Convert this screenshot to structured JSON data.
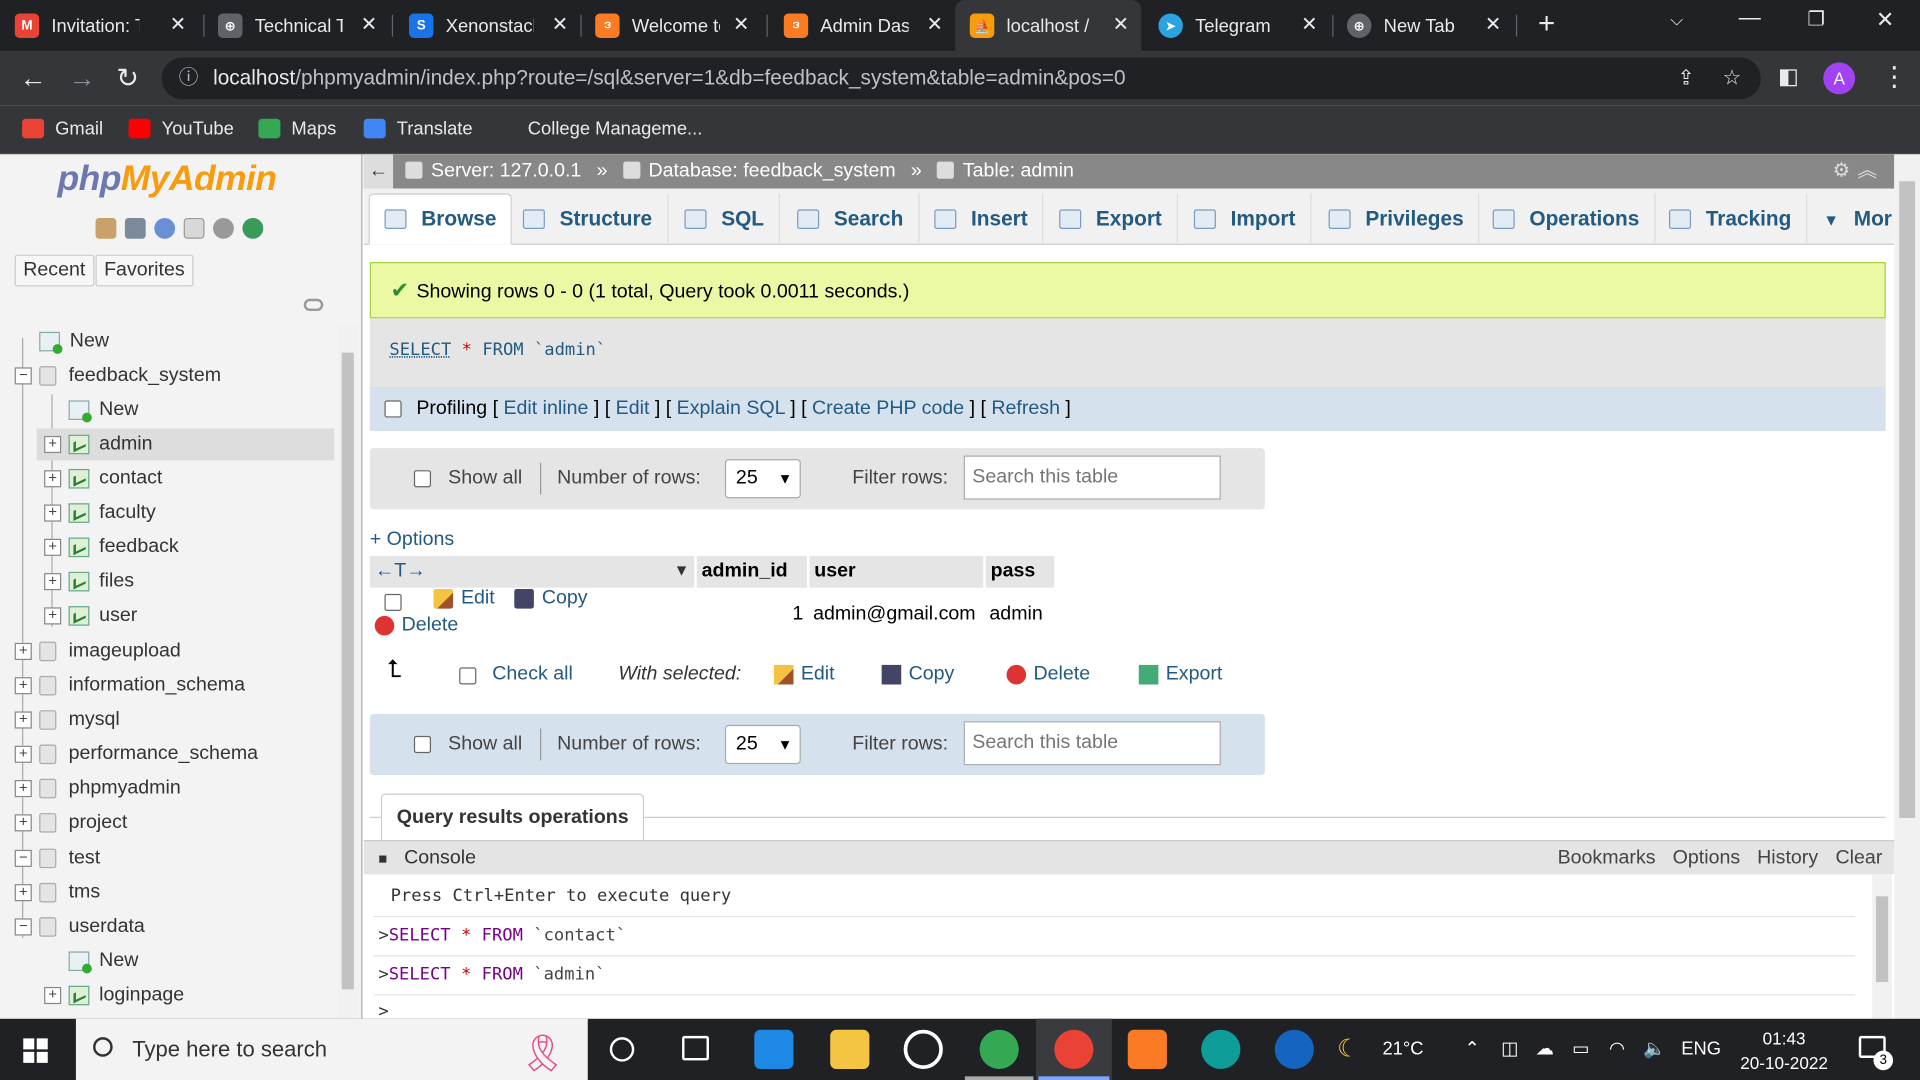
{
  "browser": {
    "tabs": [
      {
        "title": "Invitation: T",
        "color": "#ea4335",
        "glyph": "M"
      },
      {
        "title": "Technical Ta",
        "color": "#5f6368",
        "glyph": "⊕"
      },
      {
        "title": "Xenonstack",
        "color": "#1a73e8",
        "glyph": "S"
      },
      {
        "title": "Welcome to",
        "color": "#fb7a24",
        "glyph": "ဒ"
      },
      {
        "title": "Admin Dash",
        "color": "#fb7a24",
        "glyph": "ဒ"
      },
      {
        "title": "localhost /",
        "color": "#f89c0e",
        "glyph": "⛵"
      },
      {
        "title": "Telegram",
        "color": "#2aa3e0",
        "glyph": "➤"
      },
      {
        "title": "New Tab",
        "color": "#5f6368",
        "glyph": "⊕"
      }
    ],
    "url_host": "localhost",
    "url_path": "/phpmyadmin/index.php?route=/sql&server=1&db=feedback_system&table=admin&pos=0",
    "avatar_letter": "A",
    "bookmarks": [
      {
        "label": "Gmail",
        "color": "#ea4335"
      },
      {
        "label": "YouTube",
        "color": "#ff0000"
      },
      {
        "label": "Maps",
        "color": "#34a853"
      },
      {
        "label": "Translate",
        "color": "#4285f4"
      },
      {
        "label": "College Manageme...",
        "color": ""
      }
    ]
  },
  "nav": {
    "logo_php": "php",
    "logo_myadmin": "MyAdmin",
    "recent": "Recent",
    "favorites": "Favorites",
    "tree": {
      "new": "New",
      "db_feedback": "feedback_system",
      "fb_new": "New",
      "fb_tables": [
        "admin",
        "contact",
        "faculty",
        "feedback",
        "files",
        "user"
      ],
      "dbs": [
        "imageupload",
        "information_schema",
        "mysql",
        "performance_schema",
        "phpmyadmin",
        "project",
        "test",
        "tms",
        "userdata"
      ],
      "ud_new": "New",
      "ud_table": "loginpage"
    }
  },
  "main": {
    "breadcrumb": {
      "server": "Server: 127.0.0.1",
      "database": "Database: feedback_system",
      "table": "Table: admin"
    },
    "tabs": [
      "Browse",
      "Structure",
      "SQL",
      "Search",
      "Insert",
      "Export",
      "Import",
      "Privileges",
      "Operations",
      "Tracking",
      "Mor"
    ],
    "success": "Showing rows 0 - 0 (1 total, Query took 0.0011 seconds.)",
    "sql": {
      "select": "SELECT",
      "star": "*",
      "from": "FROM",
      "table": "`admin`"
    },
    "profiling": {
      "label": "Profiling",
      "links": [
        "Edit inline",
        "Edit",
        "Explain SQL",
        "Create PHP code",
        "Refresh"
      ]
    },
    "navbox": {
      "show_all": "Show all",
      "num_rows_label": "Number of rows:",
      "num_rows_value": "25",
      "filter_label": "Filter rows:",
      "filter_placeholder": "Search this table"
    },
    "options": "+ Options",
    "columns": [
      "admin_id",
      "user",
      "pass"
    ],
    "row": {
      "edit": "Edit",
      "copy": "Copy",
      "delete": "Delete",
      "admin_id": "1",
      "user": "admin@gmail.com",
      "pass": "admin"
    },
    "with_selected": {
      "check_all": "Check all",
      "label": "With selected:",
      "edit": "Edit",
      "copy": "Copy",
      "delete": "Delete",
      "export": "Export"
    },
    "query_results_operations": "Query results operations"
  },
  "console": {
    "title": "Console",
    "actions": [
      "Bookmarks",
      "Options",
      "History",
      "Clear"
    ],
    "hint": "Press Ctrl+Enter to execute query",
    "history": [
      {
        "select": "SELECT",
        "star": "*",
        "from": "FROM",
        "table": "`contact`"
      },
      {
        "select": "SELECT",
        "star": "*",
        "from": "FROM",
        "table": "`admin`"
      }
    ],
    "prompt": ">"
  },
  "taskbar": {
    "search_placeholder": "Type here to search",
    "temperature": "21°C",
    "language": "ENG",
    "time": "01:43",
    "date": "20-10-2022",
    "notification_count": "3"
  }
}
